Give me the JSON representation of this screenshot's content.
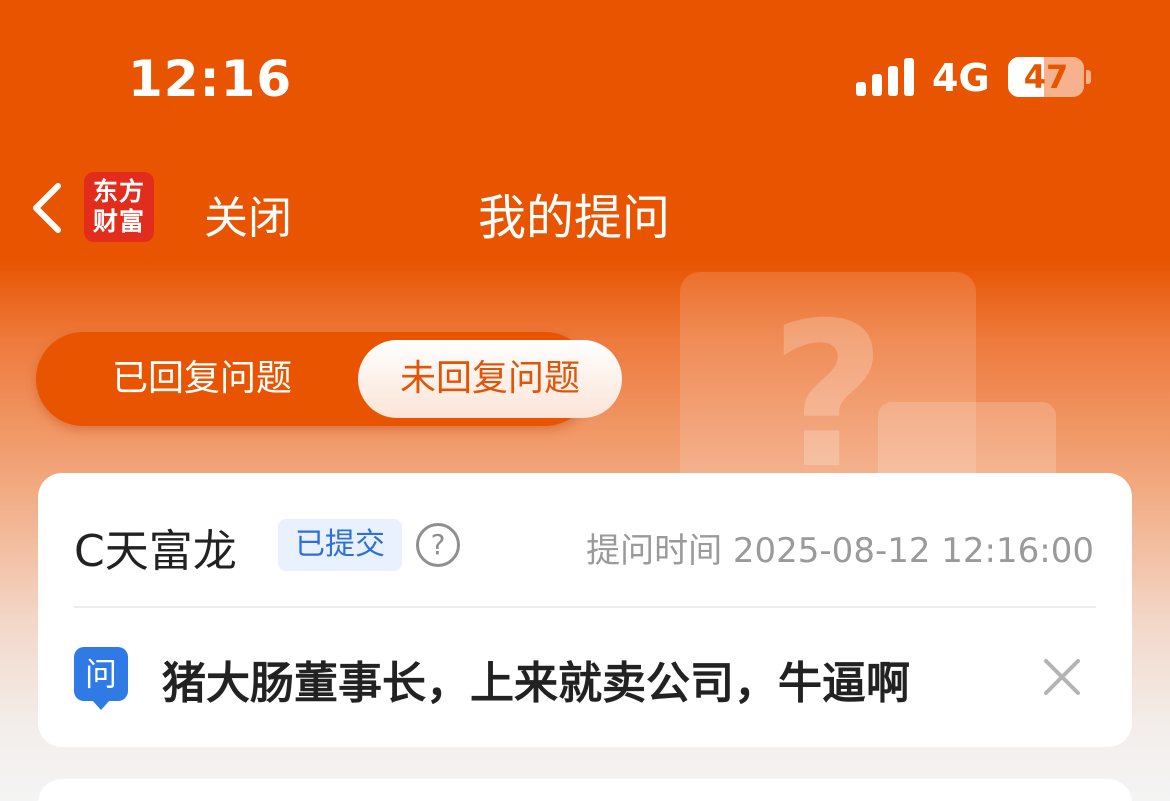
{
  "status_bar": {
    "time": "12:16",
    "network": "4G",
    "battery": "47",
    "battery_level": 0.47,
    "signal_icon": "signal-icon"
  },
  "nav": {
    "back_icon": "chevron-left-icon",
    "logo_line1": "东方",
    "logo_line2": "财富",
    "close_label": "关闭",
    "title": "我的提问"
  },
  "tabs": [
    {
      "label": "已回复问题",
      "active": false
    },
    {
      "label": "未回复问题",
      "active": true
    }
  ],
  "questions": [
    {
      "stock_name": "C天富龙",
      "status": "已提交",
      "time_label": "提问时间 2025-08-12 12:16:00",
      "q_badge": "问",
      "text": "猪大肠董事长，上来就卖公司，牛逼啊"
    }
  ],
  "colors": {
    "brand_orange": "#e85400",
    "badge_blue": "#2f6fd6",
    "question_icon_blue": "#2f7ae5",
    "logo_red": "#e22c1c"
  }
}
